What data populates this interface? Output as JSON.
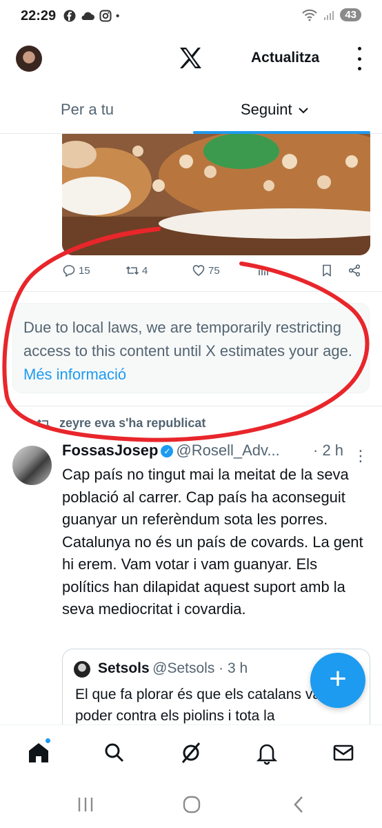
{
  "status_bar": {
    "time": "22:29",
    "app_icons": [
      "facebook-icon",
      "cloud-icon",
      "instagram-icon"
    ],
    "dot": "•",
    "battery": "43"
  },
  "app_bar": {
    "logo": "x-logo",
    "refresh_label": "Actualitza"
  },
  "tabs": [
    {
      "label": "Per a tu",
      "selected": false
    },
    {
      "label": "Seguint",
      "selected": true
    }
  ],
  "tweet_actions": {
    "replies": "15",
    "reposts": "4",
    "likes": "75"
  },
  "notice": {
    "text": "Due to local laws, we are temporarily restricting access to this content until X estimates your age.",
    "link": "Més informació"
  },
  "repost": {
    "text": "zeyre eva s'ha republicat"
  },
  "tweet": {
    "name": "FossasJosep",
    "handle": "@Rosell_Adv...",
    "time": "· 2 h",
    "text": "Cap país no tingut mai la meitat de la seva població al carrer. Cap país ha aconseguit guanyar un referèndum sota les porres. Catalunya no és un país de covards. La gent hi erem. Vam votar i vam guanyar. Els polítics han dilapidat aquest suport amb la seva mediocritat i covardia."
  },
  "quote": {
    "name": "Setsols",
    "handle": "@Setsols · 3 h",
    "text": "El que fa plorar és que els catalans vam poder contra els piolins i tota la"
  },
  "fab": {
    "icon": "plus-icon",
    "label": "+"
  },
  "colors": {
    "accent": "#1d9bf0",
    "secondary_text": "#536471",
    "annotation": "#e8262b"
  }
}
